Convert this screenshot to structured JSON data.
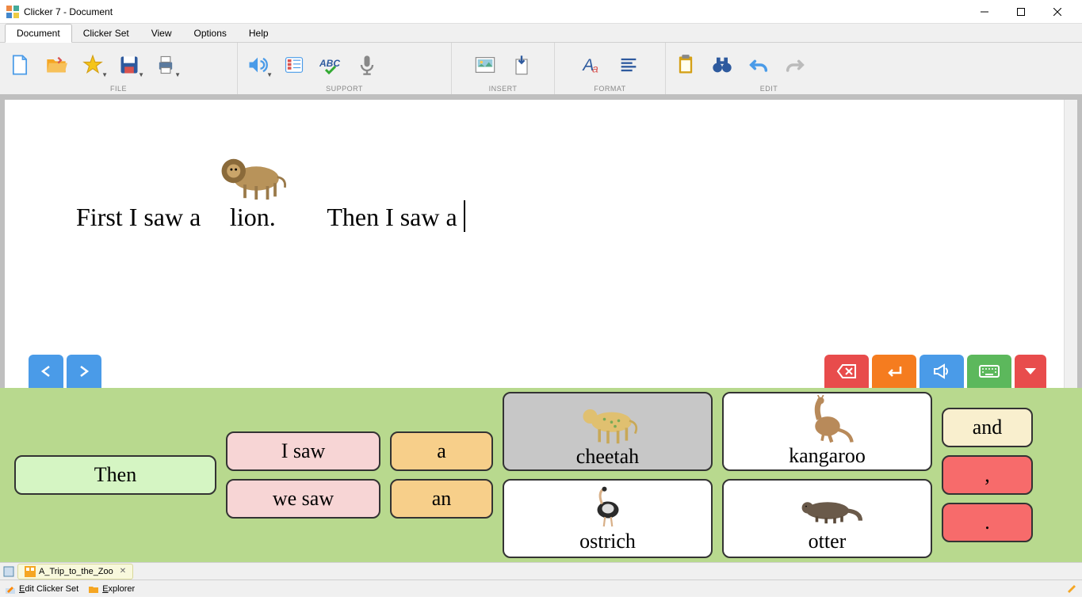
{
  "window": {
    "title": "Clicker 7 - Document"
  },
  "menu": {
    "tabs": [
      "Document",
      "Clicker Set",
      "View",
      "Options",
      "Help"
    ],
    "active": 0
  },
  "toolbar": {
    "groups": [
      {
        "label": "FILE"
      },
      {
        "label": "SUPPORT"
      },
      {
        "label": "INSERT"
      },
      {
        "label": "FORMAT"
      },
      {
        "label": "EDIT"
      }
    ]
  },
  "document": {
    "text_before_image": "First I saw a",
    "image_word": "lion.",
    "text_after": "Then I saw a"
  },
  "grid": {
    "col1": {
      "then": "Then"
    },
    "col2": {
      "isaw": "I saw",
      "wesaw": "we saw"
    },
    "col3": {
      "a": "a",
      "an": "an"
    },
    "animals": {
      "cheetah": "cheetah",
      "kangaroo": "kangaroo",
      "ostrich": "ostrich",
      "otter": "otter"
    },
    "col6": {
      "and": "and",
      "comma": ",",
      "period": "."
    }
  },
  "tabs": {
    "file": "A_Trip_to_the_Zoo"
  },
  "status": {
    "edit_prefix": "E",
    "edit_rest": "dit Clicker Set",
    "explorer_prefix": "E",
    "explorer_rest": "xplorer"
  }
}
